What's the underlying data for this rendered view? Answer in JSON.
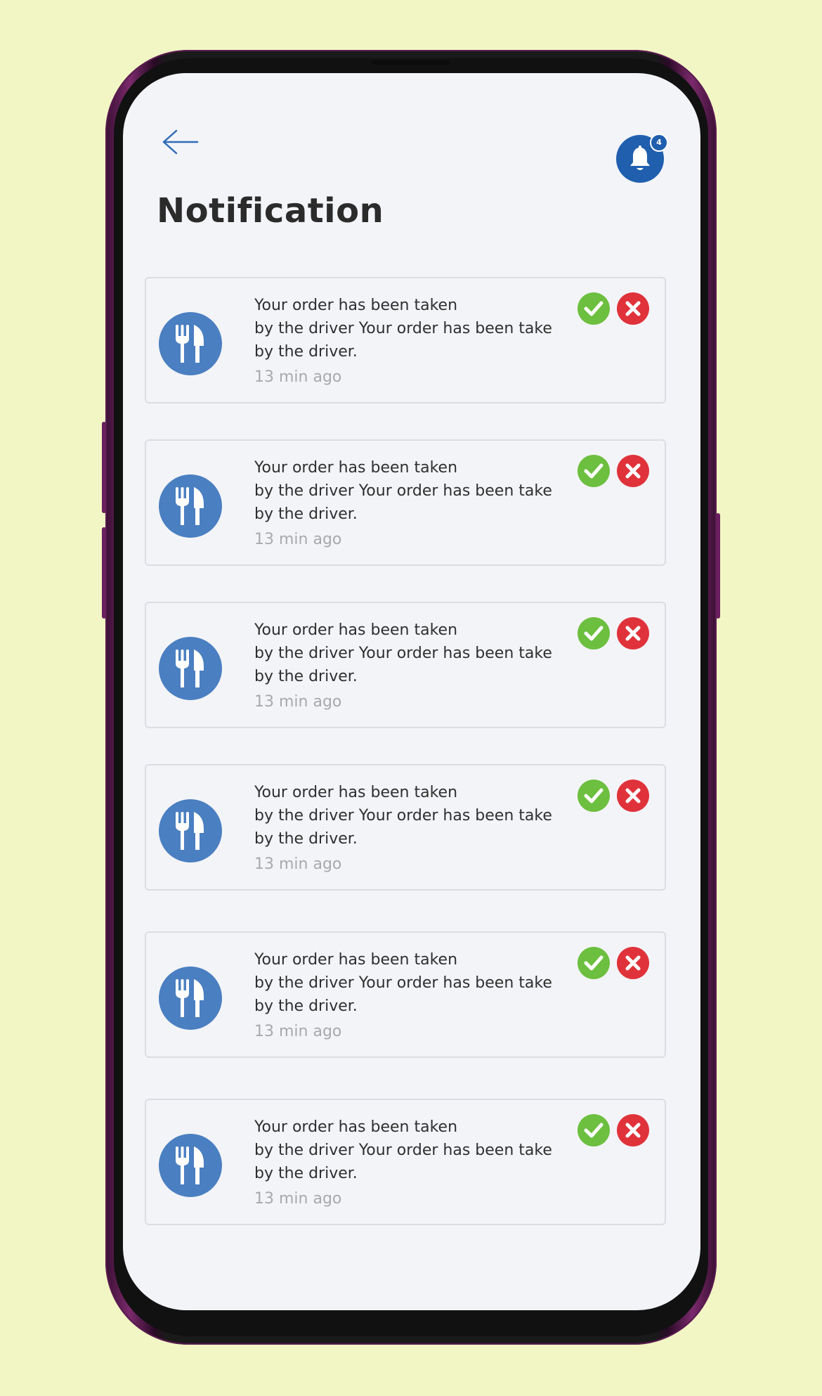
{
  "header": {
    "title": "Notification",
    "badge_count": "4",
    "back_icon": "arrow-left-icon",
    "bell_icon": "bell-icon"
  },
  "colors": {
    "background": "#f2f6c4",
    "accent": "#1f5fae",
    "avatar": "#4a7fc1",
    "accept": "#6cbf3f",
    "reject": "#e0323a"
  },
  "notifications": [
    {
      "message": "Your order has been taken\nby the driver Your order has been take\nby the driver.",
      "time": "13 min ago",
      "icon": "fork-knife-icon"
    },
    {
      "message": "Your order has been taken\nby the driver Your order has been take\nby the driver.",
      "time": "13 min ago",
      "icon": "fork-knife-icon"
    },
    {
      "message": "Your order has been taken\nby the driver Your order has been take\nby the driver.",
      "time": "13 min ago",
      "icon": "fork-knife-icon"
    },
    {
      "message": "Your order has been taken\nby the driver Your order has been take\nby the driver.",
      "time": "13 min ago",
      "icon": "fork-knife-icon"
    },
    {
      "message": "Your order has been taken\nby the driver Your order has been take\nby the driver.",
      "time": "13 min ago",
      "icon": "fork-knife-icon"
    },
    {
      "message": "Your order has been taken\nby the driver Your order has been take\nby the driver.",
      "time": "13 min ago",
      "icon": "fork-knife-icon"
    }
  ]
}
